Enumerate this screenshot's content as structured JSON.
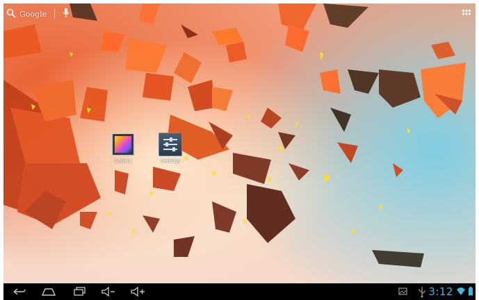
{
  "search": {
    "label": "Google",
    "icon": "search-icon",
    "voice_icon": "microphone-icon"
  },
  "apps_button_icon": "app-grid-icon",
  "desktop_icons": [
    {
      "label": "Gallery",
      "icon": "gallery-icon"
    },
    {
      "label": "Settings",
      "icon": "settings-sliders-icon"
    }
  ],
  "navbar": {
    "buttons": [
      "back-icon",
      "home-icon",
      "recent-apps-icon",
      "volume-down-icon",
      "volume-up-icon"
    ]
  },
  "status": {
    "time": "3:12",
    "icons": [
      "screenshot-icon",
      "usb-icon",
      "wifi-icon",
      "battery-icon"
    ],
    "accent": "#3db7e4"
  }
}
